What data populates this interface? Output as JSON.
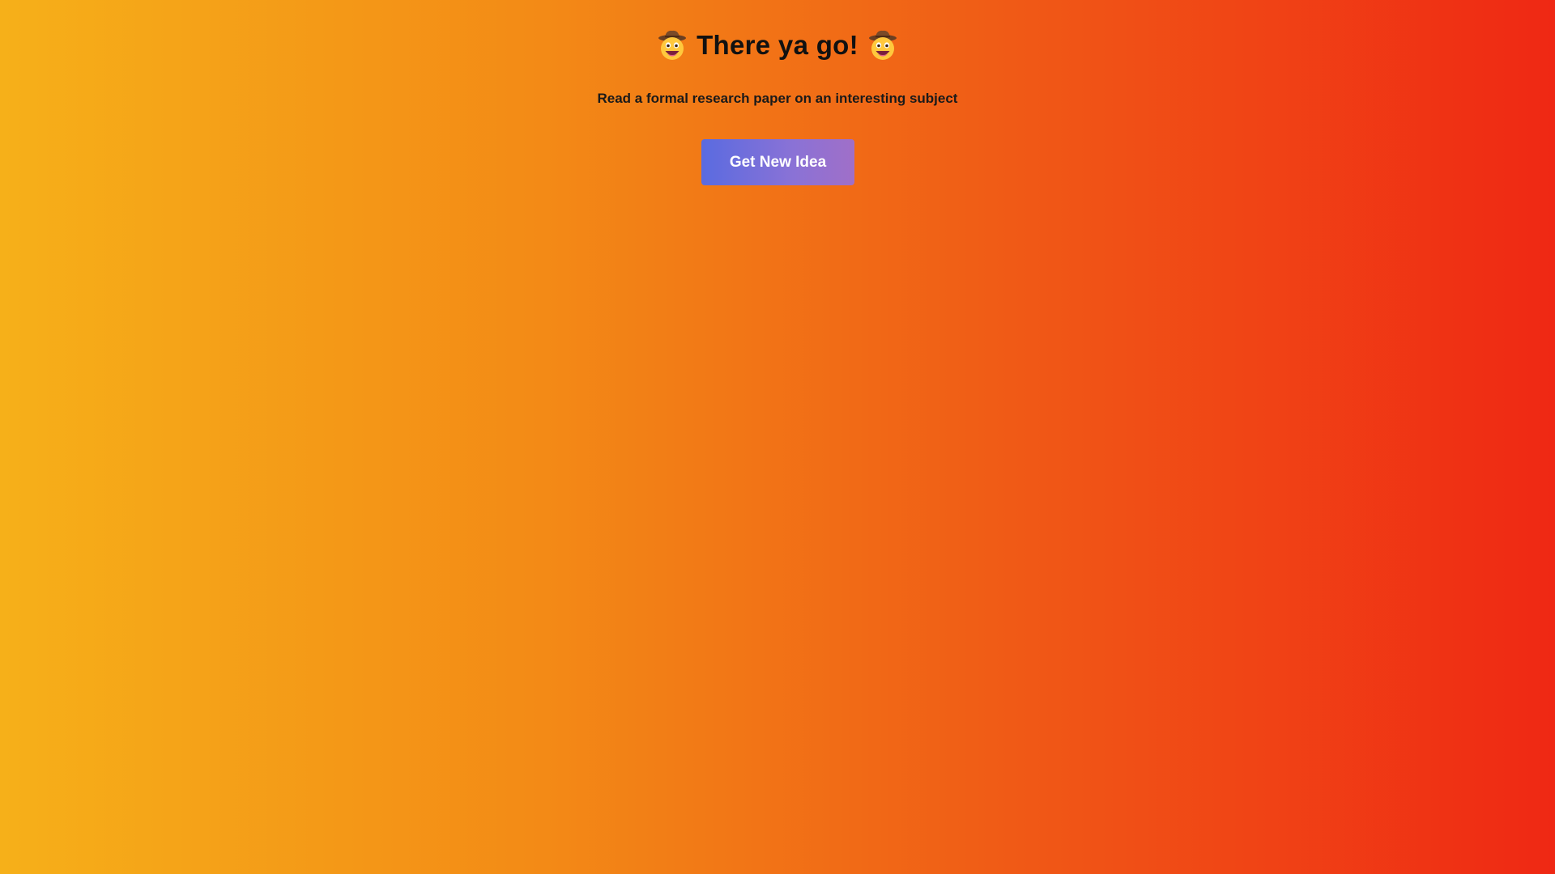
{
  "header": {
    "title": "There ya go!",
    "left_emoji": "cowboy-face-icon",
    "right_emoji": "cowboy-face-icon"
  },
  "idea": {
    "text": "Read a formal research paper on an interesting subject"
  },
  "actions": {
    "new_idea_label": "Get New Idea"
  },
  "colors": {
    "background_start": "#f6b019",
    "background_end": "#ef2814",
    "button_start": "#5a6be0",
    "button_end": "#a06fc8",
    "text": "#111111"
  }
}
